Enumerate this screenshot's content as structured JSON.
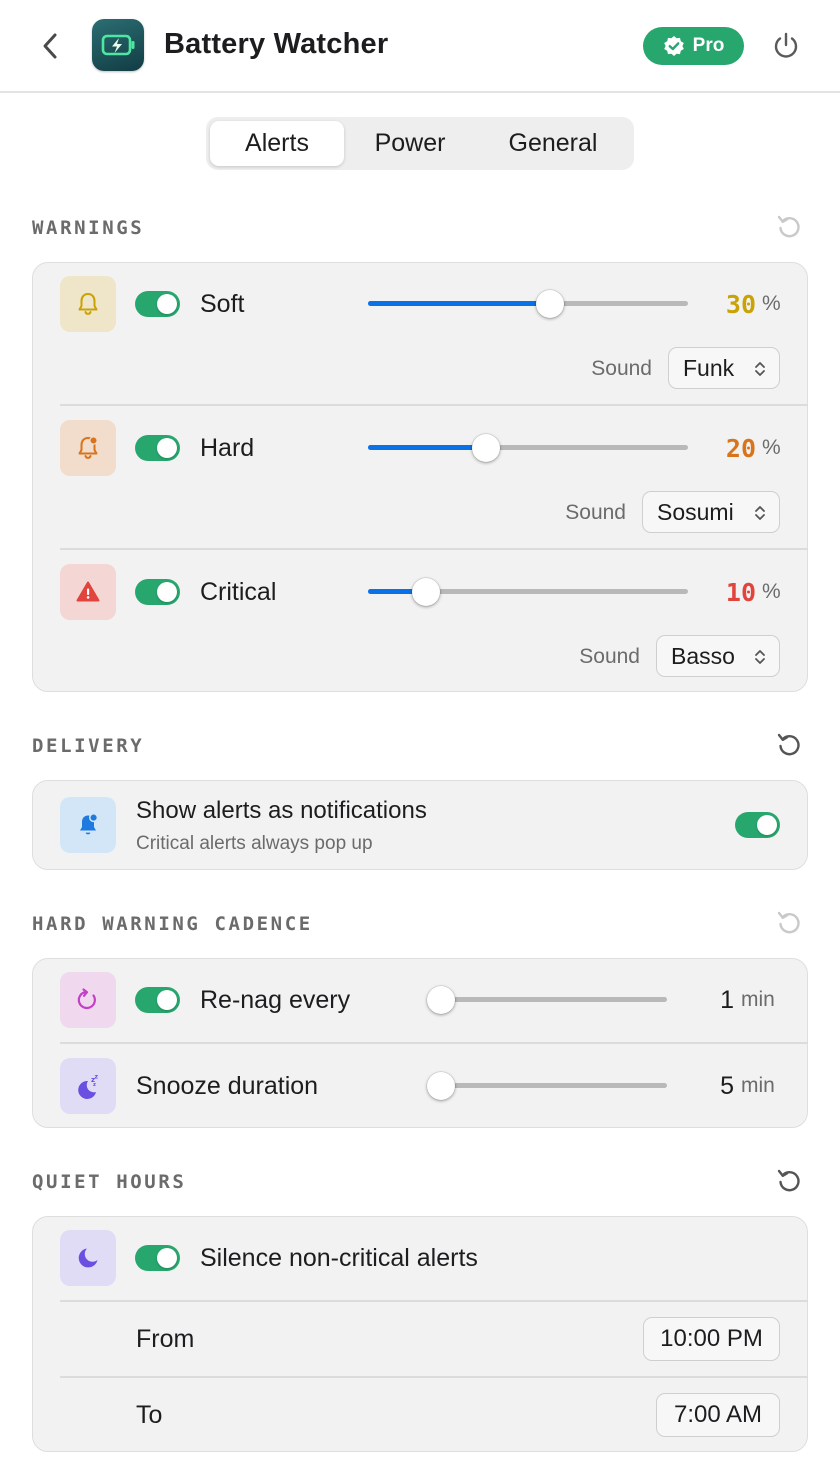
{
  "header": {
    "title": "Battery Watcher",
    "badge": "Pro"
  },
  "tabs": [
    {
      "label": "Alerts",
      "active": true
    },
    {
      "label": "Power",
      "active": false
    },
    {
      "label": "General",
      "active": false
    }
  ],
  "warnings": {
    "title": "WARNINGS",
    "rows": [
      {
        "label": "Soft",
        "enabled": true,
        "value": "30",
        "unit": "%",
        "level": 0.57,
        "color": "#c9a206",
        "sound_label": "Sound",
        "sound": "Funk",
        "icon": "bell-icon"
      },
      {
        "label": "Hard",
        "enabled": true,
        "value": "20",
        "unit": "%",
        "level": 0.37,
        "color": "#d8741c",
        "sound_label": "Sound",
        "sound": "Sosumi",
        "icon": "bell-badge-icon"
      },
      {
        "label": "Critical",
        "enabled": true,
        "value": "10",
        "unit": "%",
        "level": 0.18,
        "color": "#e0443c",
        "sound_label": "Sound",
        "sound": "Basso",
        "icon": "warning-triangle-icon"
      }
    ]
  },
  "delivery": {
    "title": "DELIVERY",
    "label": "Show alerts as notifications",
    "sublabel": "Critical alerts always pop up",
    "enabled": true
  },
  "cadence": {
    "title": "HARD WARNING CADENCE",
    "renag": {
      "label": "Re-nag every",
      "enabled": true,
      "value": "1",
      "unit": "min",
      "level": 0.0
    },
    "snooze": {
      "label": "Snooze duration",
      "value": "5",
      "unit": "min",
      "level": 0.0
    }
  },
  "quiet": {
    "title": "QUIET HOURS",
    "label": "Silence non-critical alerts",
    "enabled": true,
    "from_label": "From",
    "from_value": "10:00 PM",
    "to_label": "To",
    "to_value": "7:00 AM"
  },
  "colors": {
    "accent": "#0a72e6",
    "toggle_on": "#27a76e",
    "pro_badge": "#27a76e"
  }
}
